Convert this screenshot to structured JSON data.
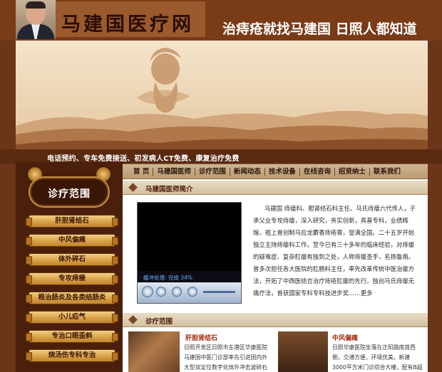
{
  "header": {
    "site_title": "马建国医疗网",
    "slogan": "治痔疮就找马建国 日照人都知道"
  },
  "banner": {
    "note": "电话预约、专车免费接送、初发病人CT免费、康复治疗免费"
  },
  "nav": {
    "items": [
      "首 页",
      "马建国医师",
      "诊疗范围",
      "新闻动态",
      "技术设备",
      "在线咨询",
      "招贤纳士",
      "联系我们"
    ]
  },
  "sidebar": {
    "title": "诊疗范围",
    "items": [
      "肝胆肾结石",
      "中风偏瘫",
      "体外碎石",
      "专攻痔瘘",
      "根治肠炎及各类结肠炎",
      "小儿疝气",
      "专治口眼歪斜",
      "烧汤伤专科专治"
    ]
  },
  "main": {
    "section1_title": "马建国医师简介",
    "video_status": "缓冲处理: 完成 34%",
    "intro_text": "马建国 痔瘘科、胆肾结石科主任。马氏痔瘘六代传人，子承父业专攻痔瘘，深入研究，务实创新，真基专科，业绩辉煌。祖上曾创制马应龙麝香痔疮膏，誉满全国。二十五岁开始独立主持痔瘘科工作，至今已有三十多年的临床经验，对痔瘘的疑难症、复杂肛瘘有独到之处，人称痔瘘圣手，名扬鲁南。曾多次担任各大医院的肛肠科主任，率先改革传统中医治瘘方法，开拓了中西医结合治疗痔疮肛瘘的先行。独创马氏痔瘘无痛疗法，曾获国家专科专科技进步奖",
    "more_label": "……更多",
    "section2_title": "诊疗范围",
    "cases": [
      {
        "title": "肝胆肾结石",
        "text": "日照开发区日照市东港区华康医院马建国中医门诊部率先引进国内外大型双定位数字化体外冲击波碎石"
      },
      {
        "title": "中风偏瘫",
        "text": "日照华康医院坐落在正阳路南首西侧，交通方便，环境优美，新建3000平方米门诊综合大楼，配有B超彩色"
      }
    ]
  },
  "colors": {
    "page_brown": "#6b3519",
    "header_brown": "#7a3b17",
    "nav_tan": "#cfb694",
    "sidebar_dark": "#4a1f0b",
    "button_gold": "#d9a24a",
    "case_title_red": "#a2280c"
  },
  "icons": {
    "section_marker": "diamond-icon",
    "video_play": "play-icon"
  }
}
